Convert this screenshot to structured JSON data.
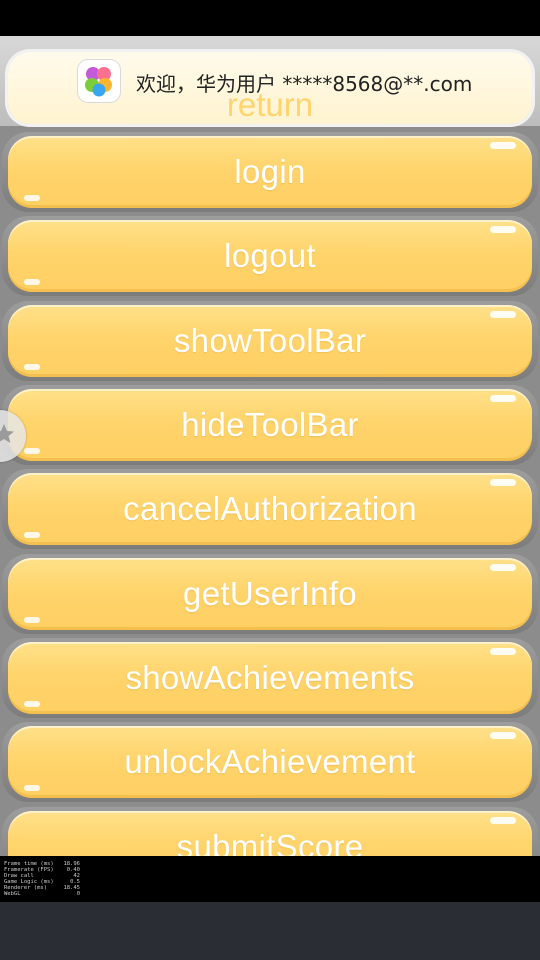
{
  "banner": {
    "ghost_label": "return",
    "welcome_text": "欢迎，华为用户 *****8568@**.com"
  },
  "buttons": [
    {
      "label": "login"
    },
    {
      "label": "logout"
    },
    {
      "label": "showToolBar"
    },
    {
      "label": "hideToolBar"
    },
    {
      "label": "cancelAuthorization"
    },
    {
      "label": "getUserInfo"
    },
    {
      "label": "showAchievements"
    },
    {
      "label": "unlockAchievement"
    },
    {
      "label": "submitScore"
    }
  ],
  "debug_stats": [
    {
      "name": "Frame time (ms)",
      "value": "18.96"
    },
    {
      "name": "Framerate (FPS)",
      "value": "0.40"
    },
    {
      "name": "Draw call",
      "value": "42"
    },
    {
      "name": "Game Logic (ms)",
      "value": "0.5"
    },
    {
      "name": "Renderer (ms)",
      "value": "18.45"
    },
    {
      "name": "WebGL",
      "value": "0"
    }
  ],
  "colors": {
    "button_fill": "#ffd46c",
    "button_text": "#ffffff",
    "banner_bg": "#fff6dc",
    "background": "#8c8c8c"
  }
}
